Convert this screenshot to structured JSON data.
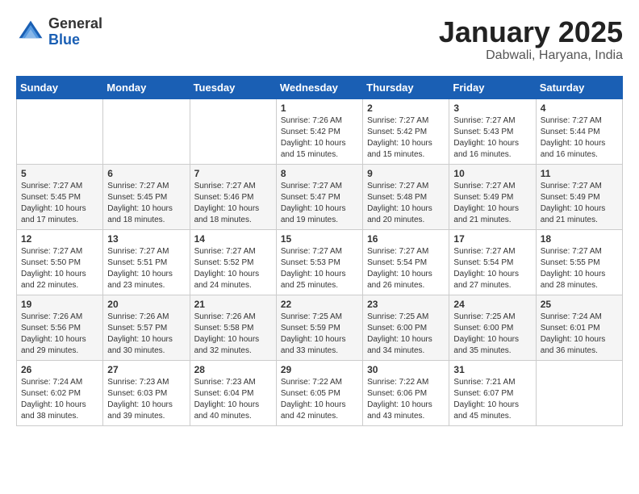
{
  "header": {
    "logo_general": "General",
    "logo_blue": "Blue",
    "month_title": "January 2025",
    "location": "Dabwali, Haryana, India"
  },
  "weekdays": [
    "Sunday",
    "Monday",
    "Tuesday",
    "Wednesday",
    "Thursday",
    "Friday",
    "Saturday"
  ],
  "weeks": [
    [
      {
        "day": "",
        "info": ""
      },
      {
        "day": "",
        "info": ""
      },
      {
        "day": "",
        "info": ""
      },
      {
        "day": "1",
        "info": "Sunrise: 7:26 AM\nSunset: 5:42 PM\nDaylight: 10 hours\nand 15 minutes."
      },
      {
        "day": "2",
        "info": "Sunrise: 7:27 AM\nSunset: 5:42 PM\nDaylight: 10 hours\nand 15 minutes."
      },
      {
        "day": "3",
        "info": "Sunrise: 7:27 AM\nSunset: 5:43 PM\nDaylight: 10 hours\nand 16 minutes."
      },
      {
        "day": "4",
        "info": "Sunrise: 7:27 AM\nSunset: 5:44 PM\nDaylight: 10 hours\nand 16 minutes."
      }
    ],
    [
      {
        "day": "5",
        "info": "Sunrise: 7:27 AM\nSunset: 5:45 PM\nDaylight: 10 hours\nand 17 minutes."
      },
      {
        "day": "6",
        "info": "Sunrise: 7:27 AM\nSunset: 5:45 PM\nDaylight: 10 hours\nand 18 minutes."
      },
      {
        "day": "7",
        "info": "Sunrise: 7:27 AM\nSunset: 5:46 PM\nDaylight: 10 hours\nand 18 minutes."
      },
      {
        "day": "8",
        "info": "Sunrise: 7:27 AM\nSunset: 5:47 PM\nDaylight: 10 hours\nand 19 minutes."
      },
      {
        "day": "9",
        "info": "Sunrise: 7:27 AM\nSunset: 5:48 PM\nDaylight: 10 hours\nand 20 minutes."
      },
      {
        "day": "10",
        "info": "Sunrise: 7:27 AM\nSunset: 5:49 PM\nDaylight: 10 hours\nand 21 minutes."
      },
      {
        "day": "11",
        "info": "Sunrise: 7:27 AM\nSunset: 5:49 PM\nDaylight: 10 hours\nand 21 minutes."
      }
    ],
    [
      {
        "day": "12",
        "info": "Sunrise: 7:27 AM\nSunset: 5:50 PM\nDaylight: 10 hours\nand 22 minutes."
      },
      {
        "day": "13",
        "info": "Sunrise: 7:27 AM\nSunset: 5:51 PM\nDaylight: 10 hours\nand 23 minutes."
      },
      {
        "day": "14",
        "info": "Sunrise: 7:27 AM\nSunset: 5:52 PM\nDaylight: 10 hours\nand 24 minutes."
      },
      {
        "day": "15",
        "info": "Sunrise: 7:27 AM\nSunset: 5:53 PM\nDaylight: 10 hours\nand 25 minutes."
      },
      {
        "day": "16",
        "info": "Sunrise: 7:27 AM\nSunset: 5:54 PM\nDaylight: 10 hours\nand 26 minutes."
      },
      {
        "day": "17",
        "info": "Sunrise: 7:27 AM\nSunset: 5:54 PM\nDaylight: 10 hours\nand 27 minutes."
      },
      {
        "day": "18",
        "info": "Sunrise: 7:27 AM\nSunset: 5:55 PM\nDaylight: 10 hours\nand 28 minutes."
      }
    ],
    [
      {
        "day": "19",
        "info": "Sunrise: 7:26 AM\nSunset: 5:56 PM\nDaylight: 10 hours\nand 29 minutes."
      },
      {
        "day": "20",
        "info": "Sunrise: 7:26 AM\nSunset: 5:57 PM\nDaylight: 10 hours\nand 30 minutes."
      },
      {
        "day": "21",
        "info": "Sunrise: 7:26 AM\nSunset: 5:58 PM\nDaylight: 10 hours\nand 32 minutes."
      },
      {
        "day": "22",
        "info": "Sunrise: 7:25 AM\nSunset: 5:59 PM\nDaylight: 10 hours\nand 33 minutes."
      },
      {
        "day": "23",
        "info": "Sunrise: 7:25 AM\nSunset: 6:00 PM\nDaylight: 10 hours\nand 34 minutes."
      },
      {
        "day": "24",
        "info": "Sunrise: 7:25 AM\nSunset: 6:00 PM\nDaylight: 10 hours\nand 35 minutes."
      },
      {
        "day": "25",
        "info": "Sunrise: 7:24 AM\nSunset: 6:01 PM\nDaylight: 10 hours\nand 36 minutes."
      }
    ],
    [
      {
        "day": "26",
        "info": "Sunrise: 7:24 AM\nSunset: 6:02 PM\nDaylight: 10 hours\nand 38 minutes."
      },
      {
        "day": "27",
        "info": "Sunrise: 7:23 AM\nSunset: 6:03 PM\nDaylight: 10 hours\nand 39 minutes."
      },
      {
        "day": "28",
        "info": "Sunrise: 7:23 AM\nSunset: 6:04 PM\nDaylight: 10 hours\nand 40 minutes."
      },
      {
        "day": "29",
        "info": "Sunrise: 7:22 AM\nSunset: 6:05 PM\nDaylight: 10 hours\nand 42 minutes."
      },
      {
        "day": "30",
        "info": "Sunrise: 7:22 AM\nSunset: 6:06 PM\nDaylight: 10 hours\nand 43 minutes."
      },
      {
        "day": "31",
        "info": "Sunrise: 7:21 AM\nSunset: 6:07 PM\nDaylight: 10 hours\nand 45 minutes."
      },
      {
        "day": "",
        "info": ""
      }
    ]
  ]
}
